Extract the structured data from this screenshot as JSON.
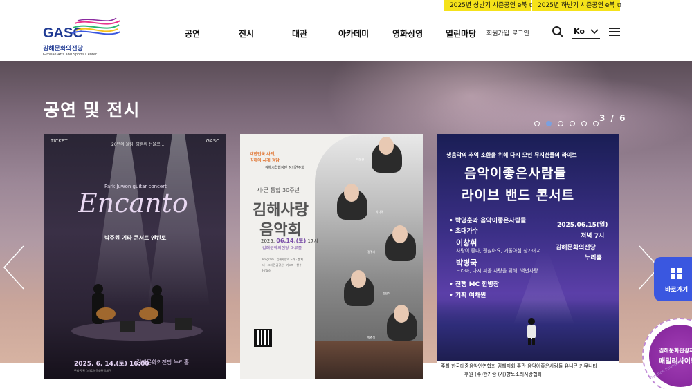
{
  "topbar": {
    "links": [
      {
        "label": "2025년 상반기 시즌공연 e북",
        "icon": "external-link-icon"
      },
      {
        "label": "2025년 하반기 시즌공연 e북",
        "icon": "external-link-icon"
      }
    ],
    "accent": "#f5e21a"
  },
  "header": {
    "logo": {
      "mark": "GASC",
      "ko": "김해문화의전당",
      "en": "Gimhae Arts and Sports Center"
    },
    "menu": [
      "공연",
      "전시",
      "대관",
      "아카데미",
      "영화상영",
      "열린마당"
    ],
    "util": [
      "회원가입",
      "로그인"
    ],
    "lang": "Ko"
  },
  "hero": {
    "title": "공연 및 전시",
    "counter": "3 / 6",
    "dots_total": 6,
    "dots_active": 1
  },
  "posters": [
    {
      "top_left": "TICKET",
      "top_center": "20년의 울림, 영혼의 선율로...",
      "top_right": "GASC",
      "sub_en": "Park Juwon guitar concert",
      "title": "Encanto",
      "sub_ko": "박주원 기타 콘서트 엔칸토",
      "date": "2025. 6. 14.(토) 16:00",
      "venue": "김해문화의전당 누리홀",
      "fine": "주최·주관 (재)김해문화관광재단"
    },
    {
      "orange1": "대한민국 사계,",
      "orange2": "김해의 사계 정담",
      "small_top": "김해시립합창단 정기연주회",
      "subhead": "시·군 통합 30주년",
      "title1": "김해사랑",
      "title2": "음악회",
      "date_prefix": "2025.",
      "date_bold": "06.14.(토)",
      "date_suffix": "17시",
      "venue": "김해문화의전당 마루홀",
      "program": "Program · 김해사랑의 노래 · 봄처녀 · 그리운 금강산 · 가고파 · 향수 · Finale",
      "performers": [
        "이동환",
        "박다해",
        "정주리",
        "방용석",
        "박춘식"
      ]
    },
    {
      "tag": "생음악의 추억 소환을 위해 다시 모인 뮤지션들의 라이브",
      "title1": "음악이좋은사람들",
      "title2": "라이브 밴드 콘서트",
      "items": [
        {
          "text": "• 박영훈과 음악이좋은사람들"
        },
        {
          "text": "• 초대가수"
        },
        {
          "text": "이창휘"
        },
        {
          "text": "사랑이 좋다, 괜찮아요, 거울아침 창가에서"
        },
        {
          "text": "박병국"
        },
        {
          "text": "드라마, 다시 피올 사랑을 위해, 백년사랑"
        },
        {
          "text": "• 진행   MC 한병창"
        },
        {
          "text": "• 기획   여채원"
        }
      ],
      "date": "2025.06.15(일)",
      "time": "저녁 7시",
      "venue1": "김해문화의전당",
      "venue2": "누리홀",
      "footer1": "주최  한국대중음악인연합회 김해지회    주관  음악이좋은사람들    유니콘 커뮤니티",
      "footer2": "후원  (주)한가람    (사)향토소리사랑협회"
    }
  ],
  "quick": {
    "label": "바로가기"
  },
  "badge": {
    "line1": "김해문화관광재단",
    "line2": "패밀리사이트",
    "arc": "Gimhae Foundation"
  }
}
